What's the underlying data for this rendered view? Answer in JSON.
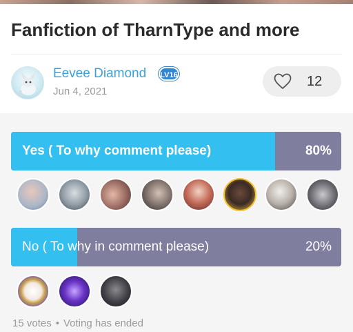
{
  "post": {
    "title": "Fanfiction of TharnType and more",
    "author": "Eevee Diamond",
    "level": "LV16",
    "date": "Jun 4, 2021",
    "likes": "12"
  },
  "poll": {
    "options": [
      {
        "label": "Yes ( To why comment please)",
        "percent_text": "80%",
        "percent": 80,
        "voter_count_shown": 8
      },
      {
        "label": "No ( To why in comment please)",
        "percent_text": "20%",
        "percent": 20,
        "voter_count_shown": 3
      }
    ],
    "votes": "15 votes",
    "separator": "•",
    "status": "Voting has ended"
  },
  "colors": {
    "accent_fill": "#33bfef",
    "bar_track": "#7f7e9e",
    "author_link": "#3ea0d8",
    "level_badge": "#2f86d6"
  },
  "icons": {
    "like": "heart-outline-icon",
    "author_avatar": "eevee-avatar",
    "level": "level-badge"
  }
}
